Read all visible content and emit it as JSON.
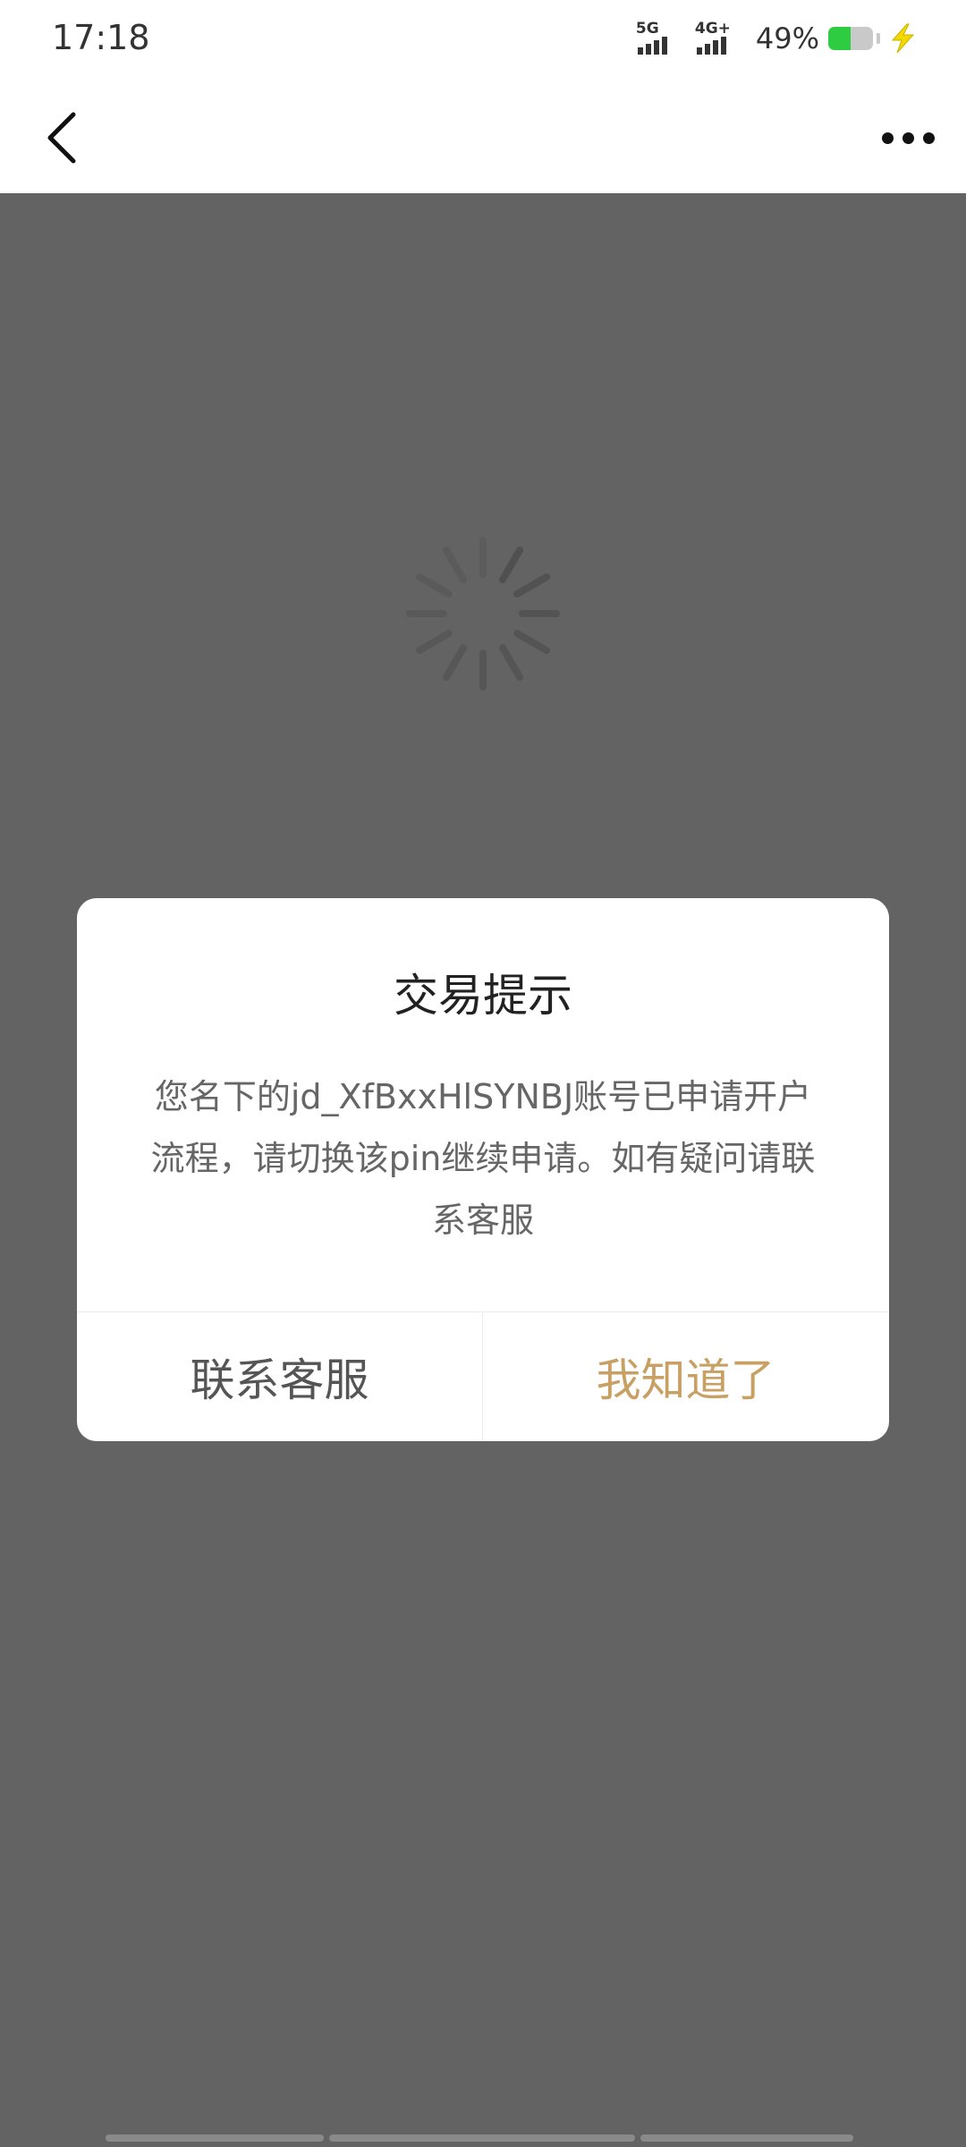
{
  "status_bar": {
    "time": "17:18",
    "network_1": "5G",
    "network_2": "4G+",
    "battery_percent": "49%",
    "battery_level": 0.49
  },
  "nav": {
    "back_icon": "chevron-left-icon",
    "more_icon": "more-horizontal-icon"
  },
  "loading": {
    "icon": "spinner-icon"
  },
  "dialog": {
    "title": "交易提示",
    "message": "您名下的jd_XfBxxHlSYNBJ账号已申请开户流程，请切换该pin继续申请。如有疑问请联系客服",
    "contact_button": "联系客服",
    "ok_button": "我知道了"
  },
  "colors": {
    "accent": "#c9a063",
    "overlay": "#636363",
    "battery_fill": "#2ecc40",
    "charge": "#f5d800"
  }
}
